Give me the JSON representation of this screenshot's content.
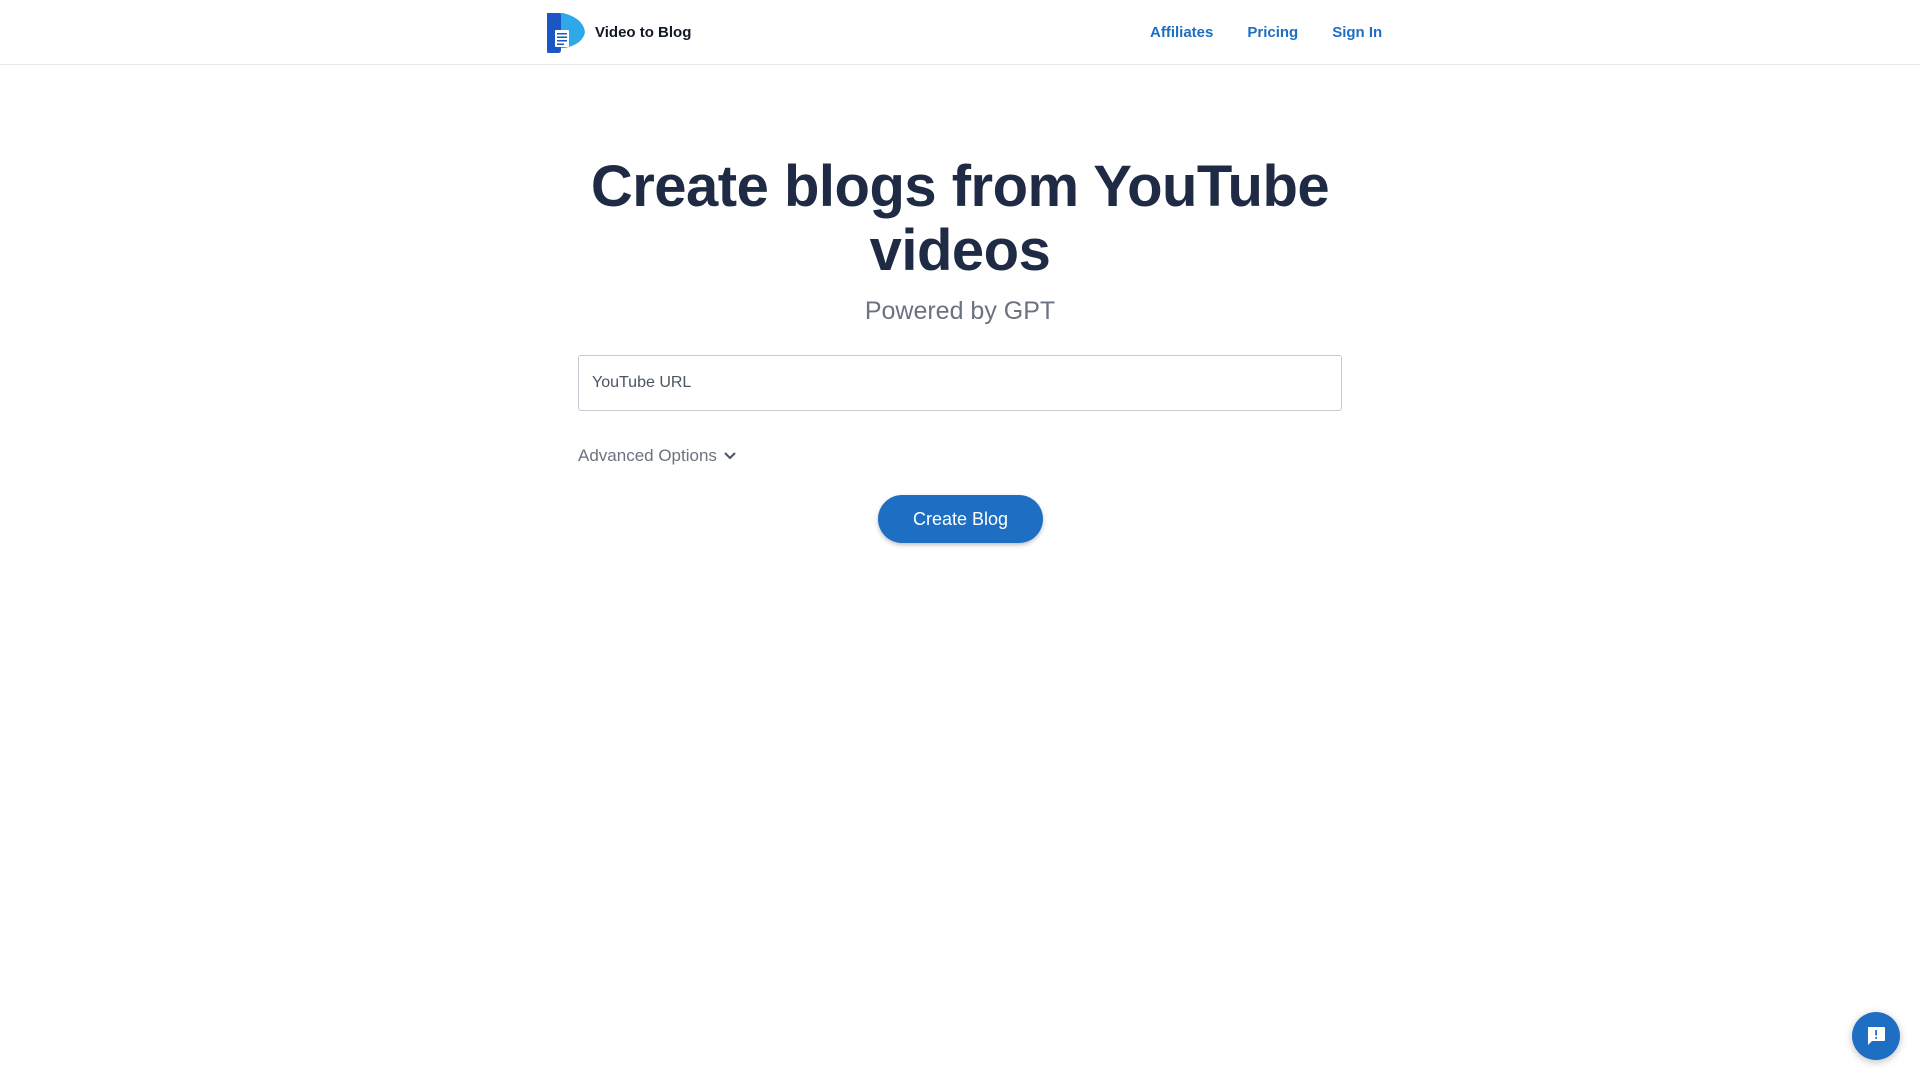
{
  "header": {
    "brand_name": "Video to Blog",
    "logo_icon": "document-play-logo",
    "nav": [
      {
        "label": "Affiliates"
      },
      {
        "label": "Pricing"
      },
      {
        "label": "Sign In"
      }
    ]
  },
  "hero": {
    "title": "Create blogs from YouTube videos",
    "subtitle": "Powered by GPT"
  },
  "form": {
    "url_placeholder": "YouTube URL",
    "url_value": "",
    "advanced_label": "Advanced Options",
    "advanced_icon": "chevron-down-icon",
    "submit_label": "Create Blog"
  },
  "chat_widget": {
    "icon": "chat-alert-icon"
  },
  "colors": {
    "accent": "#1e6fc3",
    "heading": "#1f2a44",
    "muted": "#6b7280",
    "logo_dark": "#1a56c4",
    "logo_light": "#2fa8ea"
  }
}
